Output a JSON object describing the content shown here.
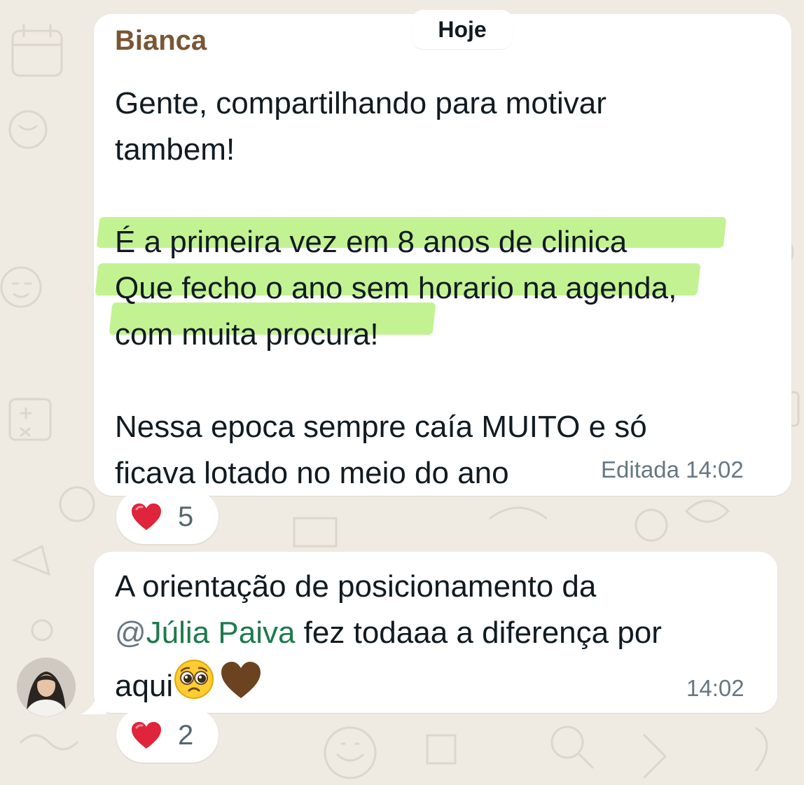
{
  "colors": {
    "background": "#efeae2",
    "bubble": "#ffffff",
    "sender_name": "#7a5634",
    "highlight": "#b9f080",
    "mention": "#1e7a4c",
    "meta_text": "#667781",
    "heart": "#e0243b"
  },
  "date_separator": "Hoje",
  "messages": [
    {
      "sender": "Bianca",
      "lines": [
        "Gente, compartilhando para motivar",
        "tambem!",
        "É a primeira vez em 8 anos de clinica",
        "Que fecho o ano sem horario na agenda,",
        "com muita procura!",
        "Nessa epoca sempre caía MUITO e só",
        "ficava lotado no meio do ano"
      ],
      "edited_label": "Editada",
      "time": "14:02",
      "reaction": {
        "icon": "red-heart-icon",
        "count": "5"
      }
    },
    {
      "line1": "A orientação de posicionamento da",
      "mention_at": "@",
      "mention_name": "Júlia Paiva",
      "line2_rest": " fez todaaa a diferença por",
      "line3": "aqui",
      "emojis": [
        "pleading-face-icon",
        "brown-heart-icon"
      ],
      "time": "14:02",
      "reaction": {
        "icon": "red-heart-icon",
        "count": "2"
      }
    }
  ]
}
